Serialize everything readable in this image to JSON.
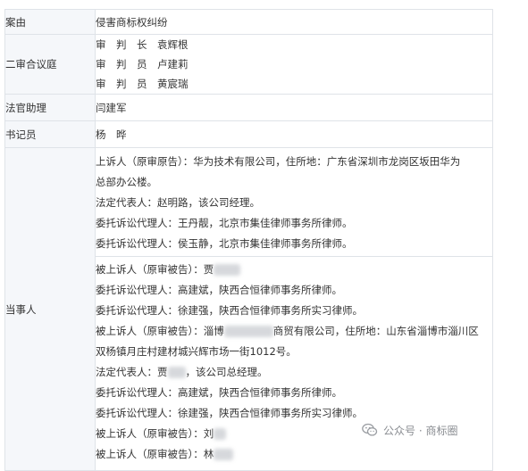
{
  "rows": {
    "case": {
      "label": "案由",
      "value": "侵害商标权纠纷"
    },
    "panel": {
      "label": "二审合议庭",
      "members": [
        "审　判　长　袁辉根",
        "审　判　员　卢建莉",
        "审　判　员　黄宸瑞"
      ]
    },
    "assistant": {
      "label": "法官助理",
      "value": "闫建军"
    },
    "clerk": {
      "label": "书记员",
      "value": "杨　晔"
    },
    "parties": {
      "label": "当事人",
      "appellant": [
        "上诉人（原审原告）：华为技术有限公司，住所地：广东省深圳市龙岗区坂田华为",
        "总部办公楼。",
        "法定代表人：赵明路，该公司经理。",
        "委托诉讼代理人：王丹靓，北京市集佳律师事务所律师。",
        "委托诉讼代理人：侯玉静，北京市集佳律师事务所律师。"
      ],
      "appellee": [
        "被上诉人（原审被告）：贾",
        "委托诉讼代理人：高建斌，陕西合恒律师事务所律师。",
        "委托诉讼代理人：徐建强，陕西合恒律师事务所实习律师。",
        "被上诉人（原审被告）：淄博",
        "商贸有限公司，住所地：山东省淄博市淄川区",
        "双杨镇月庄村建材城兴辉市场一街1012号。",
        "法定代表人：贾",
        "，该公司总经理。",
        "委托诉讼代理人：高建斌，陕西合恒律师事务所律师。",
        "委托诉讼代理人：徐建强，陕西合恒律师事务所实习律师。",
        "被上诉人（原审被告）：刘",
        "被上诉人（原审被告）：林"
      ]
    }
  },
  "watermark": {
    "text": "公众号 · 商标圈",
    "icon": "wechat-icon"
  }
}
